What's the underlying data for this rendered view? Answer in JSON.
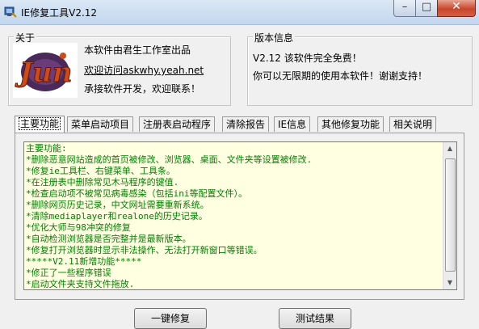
{
  "window": {
    "title": "IE修复工具V2.12",
    "min": "–",
    "max": "□",
    "close": "✕"
  },
  "about": {
    "label": "关于",
    "line1": "本软件由君生工作室出品",
    "link": "欢迎访问askwhy.yeah.net",
    "line3": "承接软件开发，欢迎联系！",
    "logo_text": "Jun"
  },
  "version": {
    "label": "版本信息",
    "line1": "V2.12  该软件完全免费！",
    "line2": "你可以无限期的使用本软件！谢谢支持！"
  },
  "tabs": [
    {
      "label": "主要功能"
    },
    {
      "label": "菜单启动项目"
    },
    {
      "label": "注册表启动程序"
    },
    {
      "label": "清除报告"
    },
    {
      "label": "IE信息"
    },
    {
      "label": "其他修复功能"
    },
    {
      "label": "相关说明"
    }
  ],
  "content_lines": [
    "主要功能:",
    "*删除恶意网站造成的首页被修改、浏览器、桌面、文件夹等设置被修改.",
    "*修复ie工具栏、右键菜单、工具条。",
    "*在注册表中删除常见木马程序的键值.",
    "*检查启动项不被常见病毒感染（包括ini等配置文件）。",
    "*删除网页历史记录，中文网址需要重新系统。",
    "*清除mediaplayer和realone的历史记录。",
    "*优化大师与98冲突的修复",
    "*自动检测浏览器是否完整并是最新版本。",
    "*修复打开浏览器时显示非法操作、无法打开新窗口等错误。",
    "*****V2.11新增功能*****",
    "*修正了一些程序错误",
    "*启动文件夹支持文件拖放."
  ],
  "buttons": {
    "repair": "一键修复",
    "test": "测试结果"
  },
  "colors": {
    "content_text": "#008000",
    "content_bg": "#ffffe1"
  }
}
